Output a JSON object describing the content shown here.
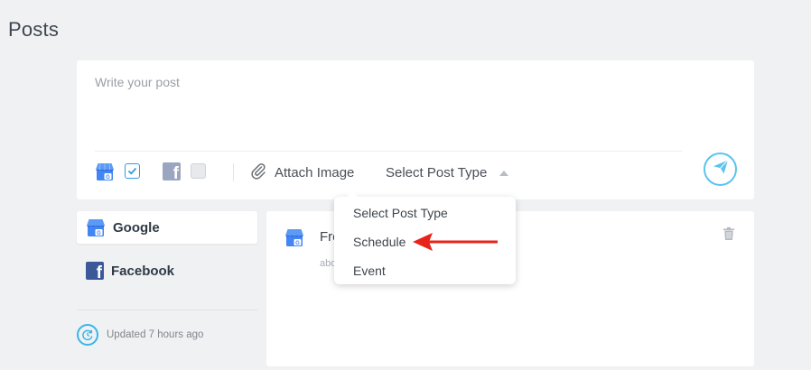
{
  "page": {
    "title": "Posts"
  },
  "composer": {
    "placeholder": "Write your post",
    "attach_label": "Attach Image",
    "post_type_label": "Select Post Type",
    "networks": [
      {
        "name": "google-my-business",
        "checked": true
      },
      {
        "name": "facebook",
        "checked": false
      }
    ]
  },
  "dropdown": {
    "options": [
      "Select Post Type",
      "Schedule",
      "Event"
    ],
    "annotation_color": "#e8231a"
  },
  "sidebar": {
    "items": [
      {
        "label": "Google",
        "icon": "google-my-business-icon",
        "active": true
      },
      {
        "label": "Facebook",
        "icon": "facebook-icon",
        "active": false
      }
    ],
    "updated_text": "Updated 7 hours ago"
  },
  "post": {
    "title": "Fre",
    "subtitle": "abo"
  },
  "colors": {
    "accent": "#38b6e8",
    "checkbox": "#2f9fe0",
    "facebook": "#3b5998",
    "gmb_blue": "#4285f4"
  }
}
